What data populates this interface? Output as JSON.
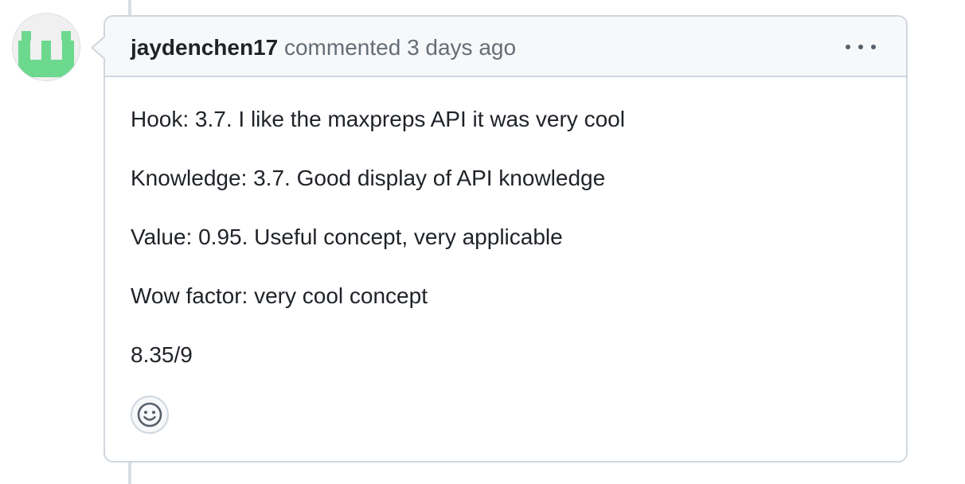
{
  "comment": {
    "author": "jaydenchen17",
    "action": "commented",
    "timestamp": "3 days ago",
    "body_lines": [
      "Hook: 3.7. I like the maxpreps API it was very cool",
      "Knowledge: 3.7. Good display of API knowledge",
      "Value: 0.95. Useful concept, very applicable",
      "Wow factor: very cool concept",
      "8.35/9"
    ]
  },
  "icons": {
    "avatar": "identicon-avatar",
    "menu": "kebab-horizontal-icon",
    "reaction": "smiley-icon"
  },
  "colors": {
    "identicon": "#6cd98f",
    "border": "#d0d7de",
    "header_bg": "#f6f8fa",
    "meta_text": "#656d76"
  }
}
